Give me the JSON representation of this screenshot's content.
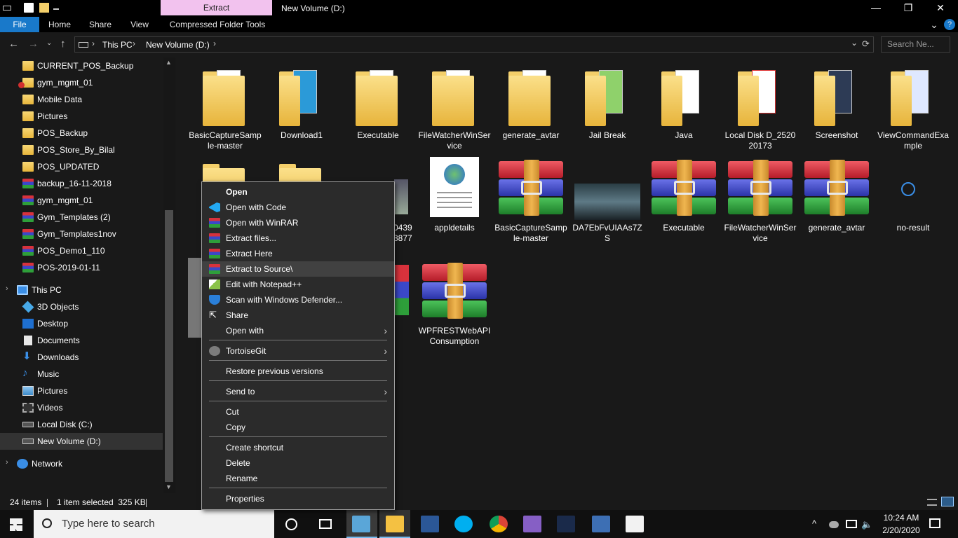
{
  "window": {
    "title": "New Volume (D:)",
    "context_tab": "Extract",
    "minimize_glyph": "—",
    "restore_glyph": "❐",
    "close_glyph": "✕"
  },
  "ribbon": {
    "tabs": [
      "File",
      "Home",
      "Share",
      "View",
      "Compressed Folder Tools"
    ],
    "help_glyph": "?",
    "expand_glyph": "⌄"
  },
  "address": {
    "crumbs": [
      "This PC",
      "New Volume (D:)"
    ],
    "sep": "›",
    "search_placeholder": "Search Ne...",
    "back": "←",
    "forward": "→",
    "up": "↑",
    "refresh": "⟳",
    "dropdown": "⌄"
  },
  "sidebar": {
    "items": [
      {
        "label": "CURRENT_POS_Backup",
        "icon": "folder-icon"
      },
      {
        "label": "gym_mgmt_01",
        "icon": "folder-error-icon"
      },
      {
        "label": "Mobile Data",
        "icon": "folder-icon"
      },
      {
        "label": "Pictures",
        "icon": "folder-icon"
      },
      {
        "label": "POS_Backup",
        "icon": "folder-icon"
      },
      {
        "label": "POS_Store_By_Bilal",
        "icon": "folder-icon"
      },
      {
        "label": "POS_UPDATED",
        "icon": "folder-icon"
      },
      {
        "label": "backup_16-11-2018",
        "icon": "winrar-icon"
      },
      {
        "label": "gym_mgmt_01",
        "icon": "winrar-icon"
      },
      {
        "label": "Gym_Templates (2)",
        "icon": "winrar-icon"
      },
      {
        "label": "Gym_Templates1nov",
        "icon": "winrar-icon"
      },
      {
        "label": "POS_Demo1_110",
        "icon": "winrar-icon"
      },
      {
        "label": "POS-2019-01-11",
        "icon": "winrar-icon"
      },
      {
        "label": "This PC",
        "icon": "computer-icon"
      },
      {
        "label": "3D Objects",
        "icon": "3d-objects-icon"
      },
      {
        "label": "Desktop",
        "icon": "desktop-icon"
      },
      {
        "label": "Documents",
        "icon": "documents-icon"
      },
      {
        "label": "Downloads",
        "icon": "downloads-icon"
      },
      {
        "label": "Music",
        "icon": "music-icon"
      },
      {
        "label": "Pictures",
        "icon": "pictures-icon"
      },
      {
        "label": "Videos",
        "icon": "videos-icon"
      },
      {
        "label": "Local Disk (C:)",
        "icon": "drive-icon"
      },
      {
        "label": "New Volume (D:)",
        "icon": "drive-icon"
      },
      {
        "label": "Network",
        "icon": "network-icon"
      }
    ]
  },
  "files": {
    "row1": [
      "BasicCaptureSample-master",
      "Download1",
      "Executable",
      "FileWatcherWinService",
      "generate_avtar",
      "Jail Break",
      "Java",
      "Local Disk D_252020173",
      "Screenshot",
      "ViewCommandExample"
    ],
    "row2": [
      "appldetails",
      "BasicCaptureSample-master",
      "DA7EbFvUIAAs7ZS",
      "Executable",
      "FileWatcherWinService",
      "generate_avtar",
      "no-result"
    ],
    "row2_partial": "0439\n8877",
    "row3": [
      "WPFRESTWebAPIConsumption"
    ]
  },
  "status": {
    "items": "24 items",
    "selected": "1 item selected  325 KB"
  },
  "taskbar": {
    "search_placeholder": "Type here to search",
    "time": "10:24 AM",
    "date": "2/20/2020"
  },
  "context_menu": {
    "items": [
      {
        "label": "Open",
        "bold": true
      },
      {
        "label": "Open with Code",
        "icon": "vscode-icon"
      },
      {
        "label": "Open with WinRAR",
        "icon": "winrar-icon"
      },
      {
        "label": "Extract files...",
        "icon": "winrar-icon"
      },
      {
        "label": "Extract Here",
        "icon": "winrar-icon"
      },
      {
        "label": "Extract to Source\\",
        "icon": "winrar-icon"
      },
      {
        "label": "Edit with Notepad++",
        "icon": "notepadpp-icon"
      },
      {
        "label": "Scan with Windows Defender...",
        "icon": "defender-icon"
      },
      {
        "label": "Share",
        "icon": "share-icon"
      },
      {
        "label": "Open with",
        "submenu": true
      },
      {
        "label": "TortoiseGit",
        "icon": "tortoisegit-icon",
        "submenu": true
      },
      {
        "label": "Restore previous versions"
      },
      {
        "label": "Send to",
        "submenu": true
      },
      {
        "label": "Cut"
      },
      {
        "label": "Copy"
      },
      {
        "label": "Create shortcut"
      },
      {
        "label": "Delete"
      },
      {
        "label": "Rename"
      },
      {
        "label": "Properties"
      }
    ],
    "arrow": "›"
  }
}
